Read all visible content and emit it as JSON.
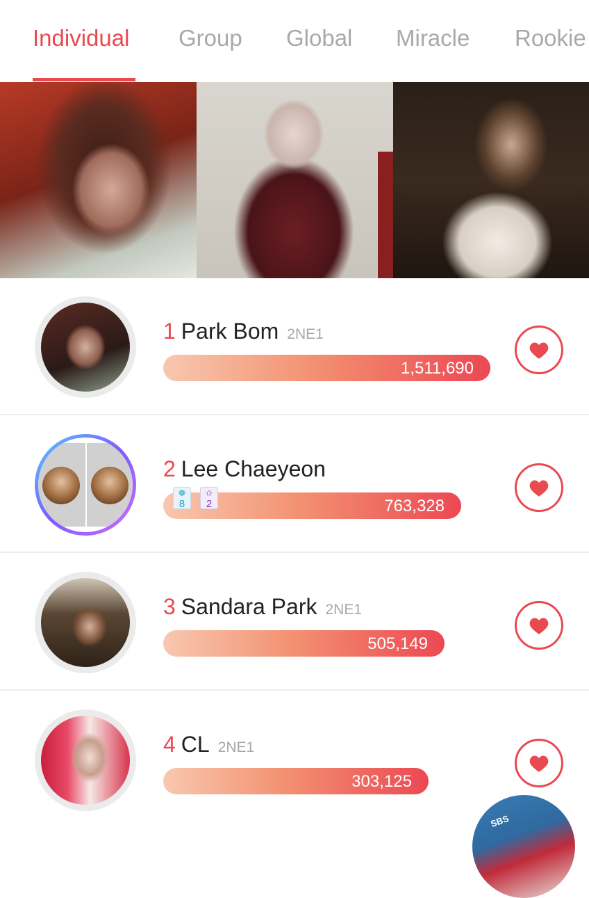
{
  "tabs": [
    {
      "label": "Individual",
      "active": true
    },
    {
      "label": "Group",
      "active": false
    },
    {
      "label": "Global",
      "active": false
    },
    {
      "label": "Miracle",
      "active": false
    },
    {
      "label": "Rookie",
      "active": false
    }
  ],
  "colors": {
    "accent": "#e84a50",
    "tab_inactive": "#a9a9a9",
    "bar_start": "#f8c8b0",
    "bar_end": "#ec4853"
  },
  "ranking": [
    {
      "rank": "1",
      "name": "Park Bom",
      "group": "2NE1",
      "votes": "1,511,690",
      "share": 1.0
    },
    {
      "rank": "2",
      "name": "Lee Chaeyeon",
      "group": "",
      "votes": "763,328",
      "share": 0.505,
      "badges": [
        {
          "icon": "angel-wing-icon",
          "count": "8"
        },
        {
          "icon": "star-icon",
          "count": "2"
        }
      ]
    },
    {
      "rank": "3",
      "name": "Sandara Park",
      "group": "2NE1",
      "votes": "505,149",
      "share": 0.334
    },
    {
      "rank": "4",
      "name": "CL",
      "group": "2NE1",
      "votes": "303,125",
      "share": 0.2
    }
  ],
  "floating_button": {
    "icon": "floating-event-icon",
    "label": "SBS"
  }
}
